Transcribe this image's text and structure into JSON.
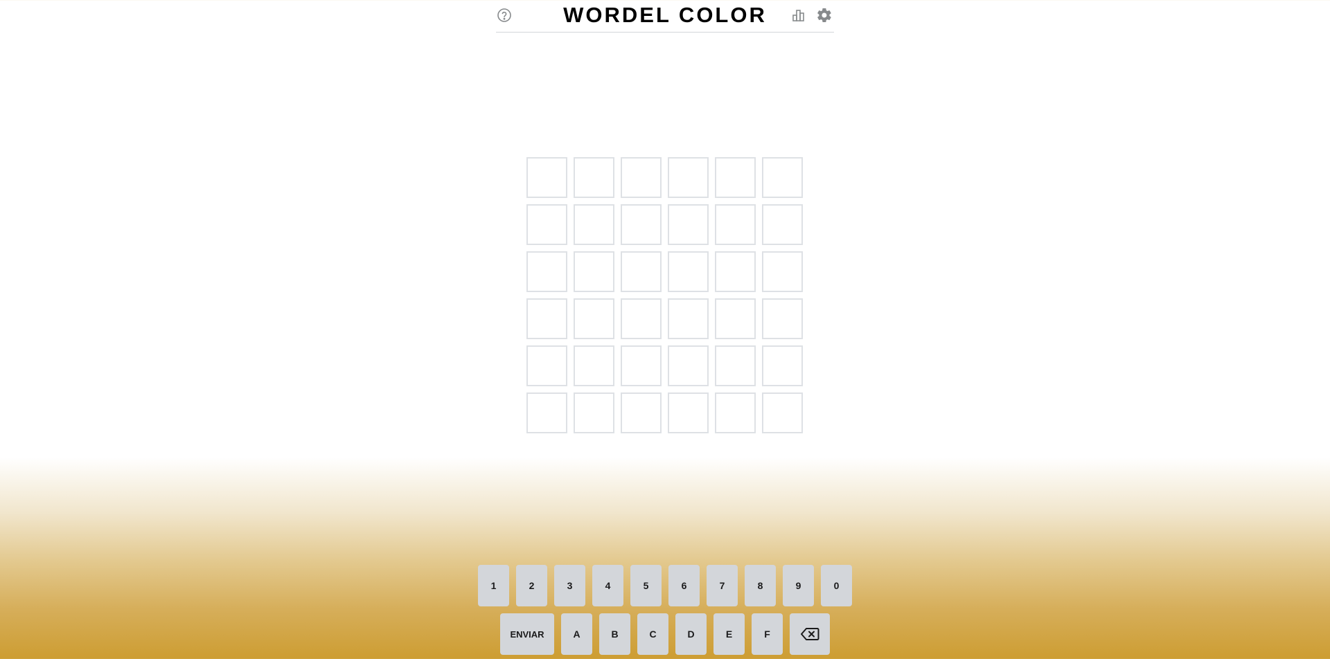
{
  "header": {
    "title": "WORDEL COLOR",
    "icons": [
      "help-icon",
      "stats-icon",
      "gear-icon"
    ]
  },
  "board": {
    "rows": 6,
    "cols": 6,
    "cells": [
      [
        "",
        "",
        "",
        "",
        "",
        ""
      ],
      [
        "",
        "",
        "",
        "",
        "",
        ""
      ],
      [
        "",
        "",
        "",
        "",
        "",
        ""
      ],
      [
        "",
        "",
        "",
        "",
        "",
        ""
      ],
      [
        "",
        "",
        "",
        "",
        "",
        ""
      ],
      [
        "",
        "",
        "",
        "",
        "",
        ""
      ]
    ]
  },
  "keyboard": {
    "row1": [
      "1",
      "2",
      "3",
      "4",
      "5",
      "6",
      "7",
      "8",
      "9",
      "0"
    ],
    "row2": [
      "A",
      "B",
      "C",
      "D",
      "E",
      "F"
    ],
    "enter_label": "ENVIAR",
    "backspace_icon": "backspace-icon"
  },
  "colors": {
    "key_bg": "#d3d6da",
    "cell_border": "#dee1e5",
    "gradient_bottom": "#cd9d32"
  }
}
